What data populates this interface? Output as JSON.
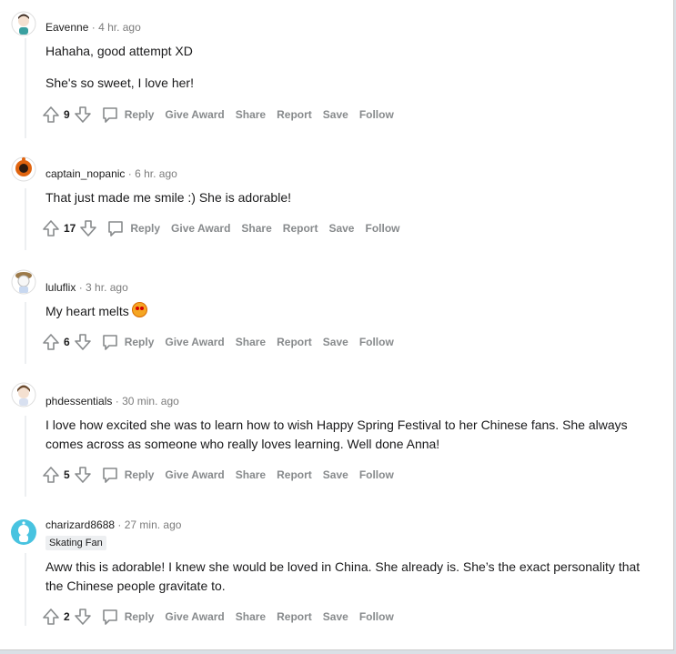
{
  "comments": [
    {
      "user": "Eavenne",
      "time": "4 hr. ago",
      "flair": "",
      "paragraphs": [
        "Hahaha, good attempt XD",
        "She's so sweet, I love her!"
      ],
      "votes": "9",
      "avatar_color": "#3aa0a0"
    },
    {
      "user": "captain_nopanic",
      "time": "6 hr. ago",
      "flair": "",
      "paragraphs": [
        "That just made me smile :) She is adorable!"
      ],
      "votes": "17",
      "avatar_color": "#e0640f"
    },
    {
      "user": "luluflix",
      "time": "3 hr. ago",
      "flair": "",
      "paragraphs": [
        "My heart melts"
      ],
      "votes": "6",
      "avatar_color": "#9c7a4a"
    },
    {
      "user": "phdessentials",
      "time": "30 min. ago",
      "flair": "",
      "paragraphs": [
        "I love how excited she was to learn how to wish Happy Spring Festival to her Chinese fans. She always comes across as someone who really loves learning. Well done Anna!"
      ],
      "votes": "5",
      "avatar_color": "#6b4a2e"
    },
    {
      "user": "charizard8688",
      "time": "27 min. ago",
      "flair": "Skating Fan",
      "paragraphs": [
        "Aww this is adorable! I knew she would be loved in China. She already is. She’s the exact personality that the Chinese people gravitate to."
      ],
      "votes": "2",
      "avatar_color": "#48c3e0"
    }
  ],
  "actions": {
    "reply": "Reply",
    "give_award": "Give Award",
    "share": "Share",
    "report": "Report",
    "save": "Save",
    "follow": "Follow"
  },
  "separator": "·"
}
